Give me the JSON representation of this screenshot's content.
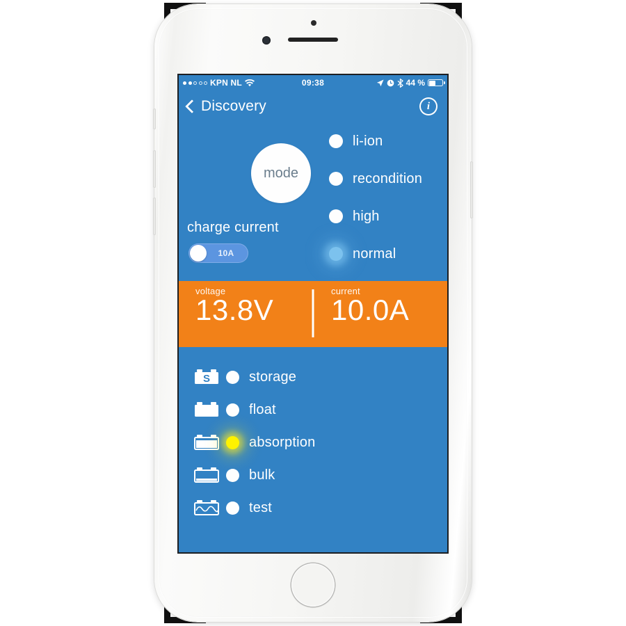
{
  "status_bar": {
    "signal_dots": [
      true,
      true,
      false,
      false,
      false
    ],
    "carrier": "KPN NL",
    "wifi_icon": "wifi-icon",
    "time": "09:38",
    "location_icon": "location-arrow-icon",
    "alarm_icon": "alarm-clock-icon",
    "bluetooth_icon": "bluetooth-icon",
    "battery_percent": "44 %",
    "battery_level": 44
  },
  "nav": {
    "back_label": "Discovery",
    "back_icon": "chevron-left-icon",
    "info_icon": "info-circle-icon",
    "info_glyph": "i"
  },
  "mode": {
    "button_label": "mode",
    "options": [
      {
        "label": "li-ion",
        "selected": false
      },
      {
        "label": "recondition",
        "selected": false
      },
      {
        "label": "high",
        "selected": false
      },
      {
        "label": "normal",
        "selected": true
      }
    ]
  },
  "charge_current": {
    "label": "charge current",
    "value": "10A",
    "toggle_on": false
  },
  "readout": {
    "voltage_label": "voltage",
    "voltage_value": "13.8V",
    "current_label": "current",
    "current_value": "10.0A"
  },
  "states": [
    {
      "label": "storage",
      "icon": "battery-storage-icon",
      "active": false
    },
    {
      "label": "float",
      "icon": "battery-full-icon",
      "active": false
    },
    {
      "label": "absorption",
      "icon": "battery-absorption-icon",
      "active": true
    },
    {
      "label": "bulk",
      "icon": "battery-bulk-icon",
      "active": false
    },
    {
      "label": "test",
      "icon": "battery-test-icon",
      "active": false
    }
  ],
  "colors": {
    "brand_blue": "#3282c4",
    "accent_orange": "#f28118",
    "active_yellow": "#fff200",
    "active_blue": "#7cc2ee",
    "toggle_track": "#5c95e0"
  }
}
